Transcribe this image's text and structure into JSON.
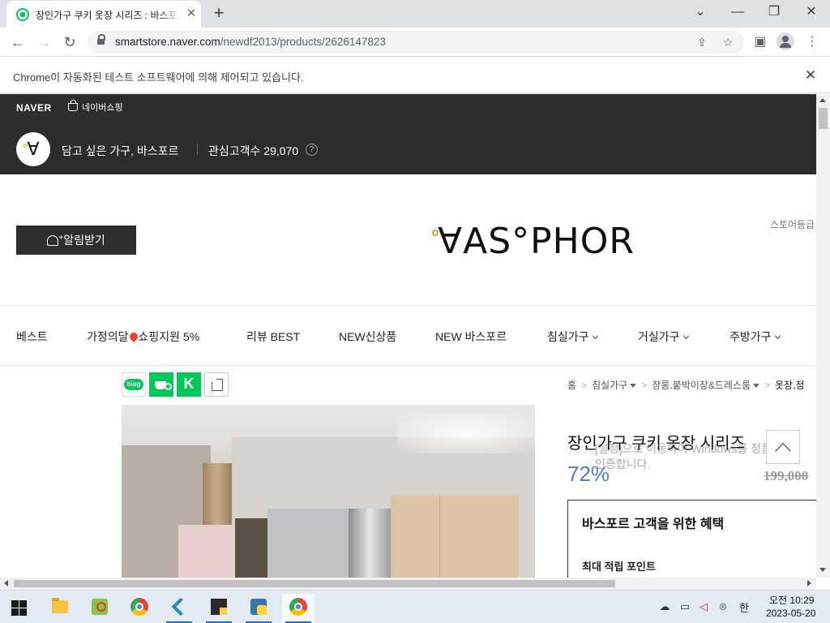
{
  "browser": {
    "tab_title": "장인가구 쿠키 옷장 시리즈 : 바스포르",
    "tab_close": "✕",
    "new_tab": "+",
    "url_host": "smartstore.naver.com",
    "url_path": "/newdf2013/products/2626147823",
    "automation_notice": "Chrome이 자동화된 테스트 소프트웨어에 의해 제어되고 있습니다.",
    "icons": [
      "back-icon",
      "forward-icon",
      "reload-icon",
      "lock-icon",
      "share-icon",
      "star-icon",
      "side-panel-icon",
      "profile-icon",
      "menu-icon"
    ]
  },
  "naver": {
    "logo": "NAVER",
    "shopping_link": "네이버쇼핑"
  },
  "store": {
    "badge_glyph": "∀",
    "name": "담고 싶은 가구, 바스포르",
    "fans_label": "관심고객수 29,070",
    "help": "?",
    "notify_button": "알림받기",
    "brand_logo": "∀AS°PHOR",
    "grade_link": "스토어등급"
  },
  "categories": [
    {
      "label": "베스트",
      "caret": false,
      "pin": false
    },
    {
      "label": "가정의달",
      "suffix": "쇼핑지원 5%",
      "caret": false,
      "pin": true
    },
    {
      "label": "리뷰 BEST",
      "caret": false,
      "pin": false
    },
    {
      "label": "NEW신상품",
      "caret": false,
      "pin": false
    },
    {
      "label": "NEW 바스포르",
      "caret": false,
      "pin": false
    },
    {
      "label": "침실가구",
      "caret": true,
      "pin": false
    },
    {
      "label": "거실가구",
      "caret": true,
      "pin": false
    },
    {
      "label": "주방가구",
      "caret": true,
      "pin": false
    }
  ],
  "share": {
    "blog_label": "blog",
    "k_label": "K"
  },
  "breadcrumb": {
    "home": "홈",
    "level1": "침실가구",
    "level2": "장롱,붙박이장&드레스룸",
    "level3": "옷장,정",
    "separator": ">"
  },
  "product": {
    "title": "장인가구 쿠키 옷장 시리즈",
    "discount": "72%",
    "original_price": "199,000",
    "benefit_title": "바스포르 고객을 위한 혜택",
    "benefit_points": "최대 적립 포인트"
  },
  "watermark": {
    "line1": "[설정]으로 이동하여 Windows를 정품",
    "line2": "인증합니다."
  },
  "taskbar": {
    "ime": "한",
    "time": "오전 10:29",
    "date": "2023-05-20",
    "apps": [
      "file-explorer",
      "maps",
      "chrome",
      "vscode",
      "sticky-notes",
      "python",
      "chrome-active"
    ]
  },
  "colors": {
    "naver_green": "#03c75a",
    "discount_blue": "#4d7fd6",
    "store_bar": "#2c2c2c"
  }
}
